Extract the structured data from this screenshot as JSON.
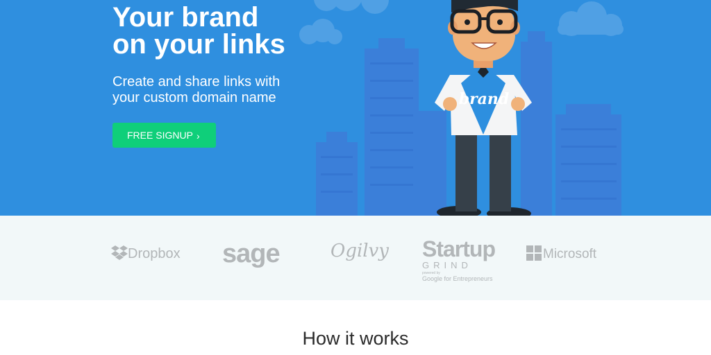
{
  "hero": {
    "headline": [
      "Your brand",
      "on your links"
    ],
    "subheadline": [
      "Create and share links with",
      "your custom domain name"
    ],
    "cta": {
      "label": "FREE SIGNUP",
      "arrow": "›"
    },
    "mascot_shirt_text": "brand",
    "colors": {
      "background": "#2f8fdf",
      "cta": "#0fcf7a"
    }
  },
  "logos": {
    "dropbox": "Dropbox",
    "sage": "sage",
    "ogilvy": "Ogilvy",
    "startup_grind": {
      "title": "Startup",
      "subtitle": "GRIND",
      "powered_by": "powered by",
      "tagline": "Google for Entrepreneurs"
    },
    "microsoft": "Microsoft",
    "color": "#b2b6b8"
  },
  "how_it_works": {
    "title": "How it works"
  }
}
